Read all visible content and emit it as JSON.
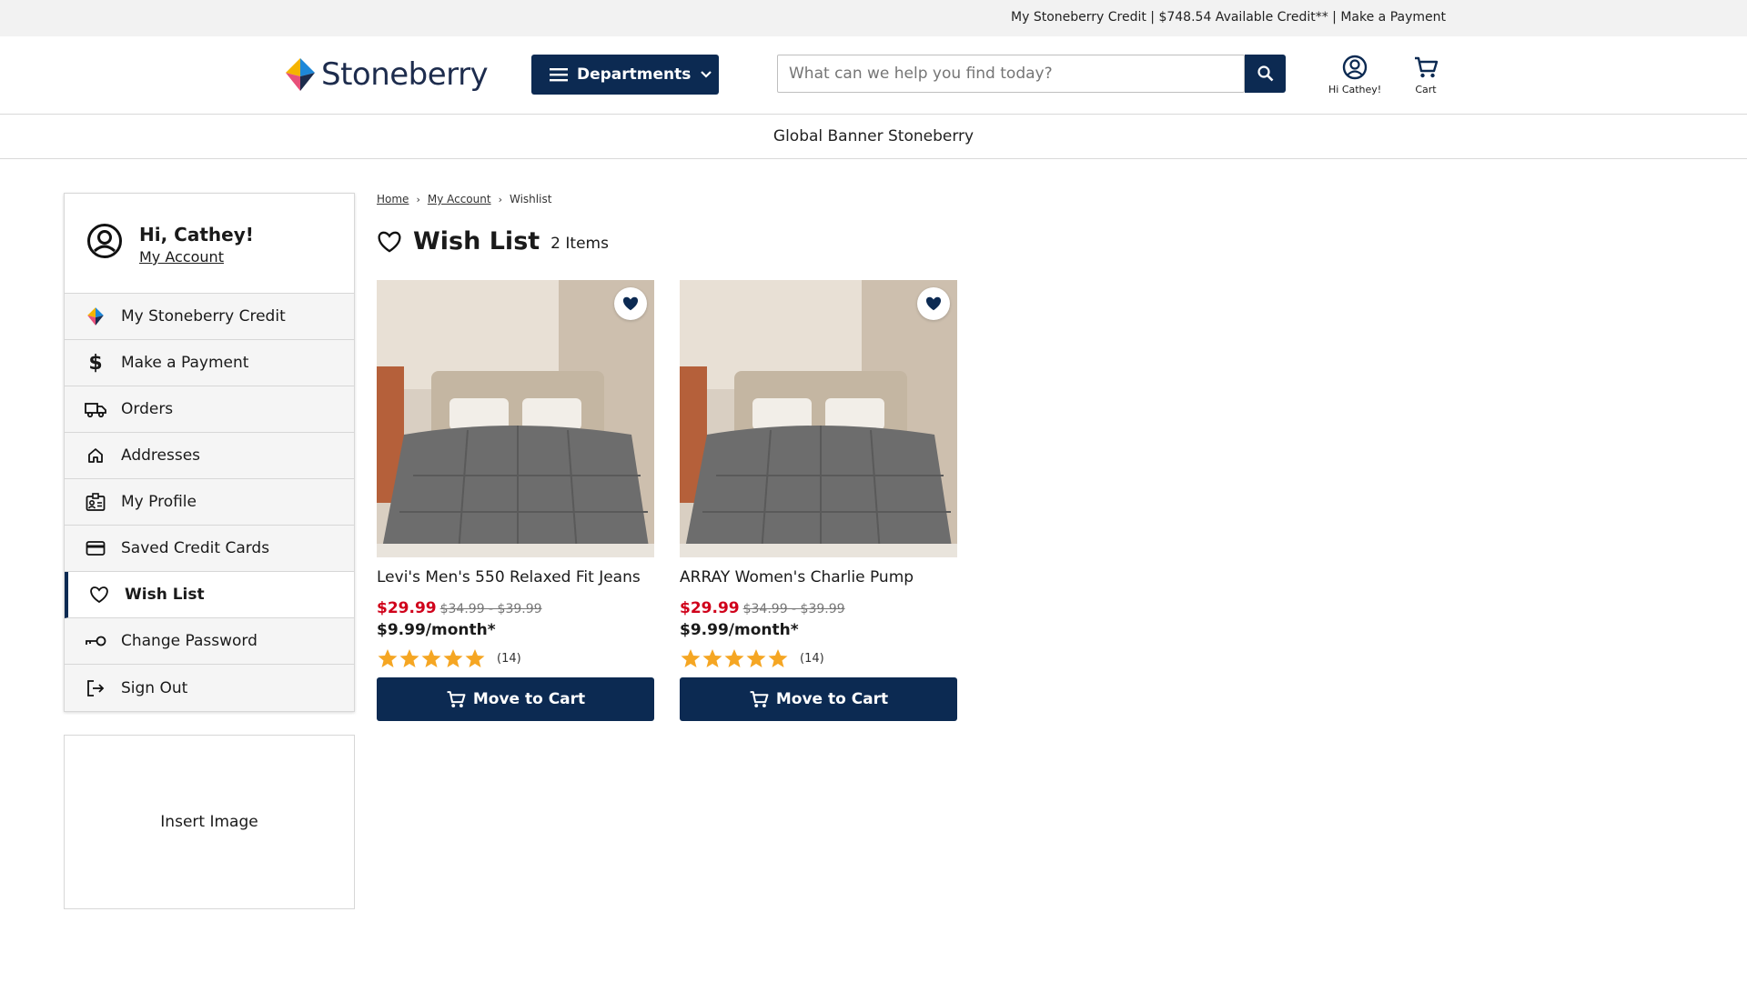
{
  "topbar": {
    "text": "My Stoneberry Credit | $748.54 Available Credit** | Make a Payment"
  },
  "header": {
    "logo_text": "Stoneberry",
    "departments_label": "Departments",
    "search_placeholder": "What can we help you find today?",
    "account_label": "Hi Cathey!",
    "cart_label": "Cart"
  },
  "banner": {
    "text": "Global Banner Stoneberry"
  },
  "sidebar": {
    "greeting": "Hi, Cathey!",
    "account_link": "My Account",
    "items": [
      {
        "label": "My Stoneberry Credit",
        "icon": "stoneberry-logo-icon"
      },
      {
        "label": "Make a Payment",
        "icon": "dollar-icon"
      },
      {
        "label": "Orders",
        "icon": "truck-icon"
      },
      {
        "label": "Addresses",
        "icon": "home-icon"
      },
      {
        "label": "My Profile",
        "icon": "id-card-icon"
      },
      {
        "label": "Saved Credit Cards",
        "icon": "credit-card-icon"
      },
      {
        "label": "Wish List",
        "icon": "heart-icon"
      },
      {
        "label": "Change Password",
        "icon": "key-icon"
      },
      {
        "label": "Sign Out",
        "icon": "sign-out-icon"
      }
    ],
    "active_index": 6
  },
  "insert_image": {
    "text": "Insert Image"
  },
  "breadcrumb": {
    "home": "Home",
    "account": "My Account",
    "current": "Wishlist"
  },
  "page": {
    "title": "Wish List",
    "count": "2 Items"
  },
  "products": [
    {
      "name": "Levi's Men's 550 Relaxed Fit Jeans",
      "sale_price": "$29.99",
      "original_price": "$34.99 - $39.99",
      "monthly": "$9.99/month*",
      "rating": 5,
      "review_count": "(14)",
      "button": "Move to Cart"
    },
    {
      "name": "ARRAY Women's Charlie Pump",
      "sale_price": "$29.99",
      "original_price": "$34.99 - $39.99",
      "monthly": "$9.99/month*",
      "rating": 5,
      "review_count": "(14)",
      "button": "Move to Cart"
    }
  ],
  "colors": {
    "navy": "#0c2a52",
    "sale_red": "#d0021b",
    "star": "#f5a623"
  }
}
